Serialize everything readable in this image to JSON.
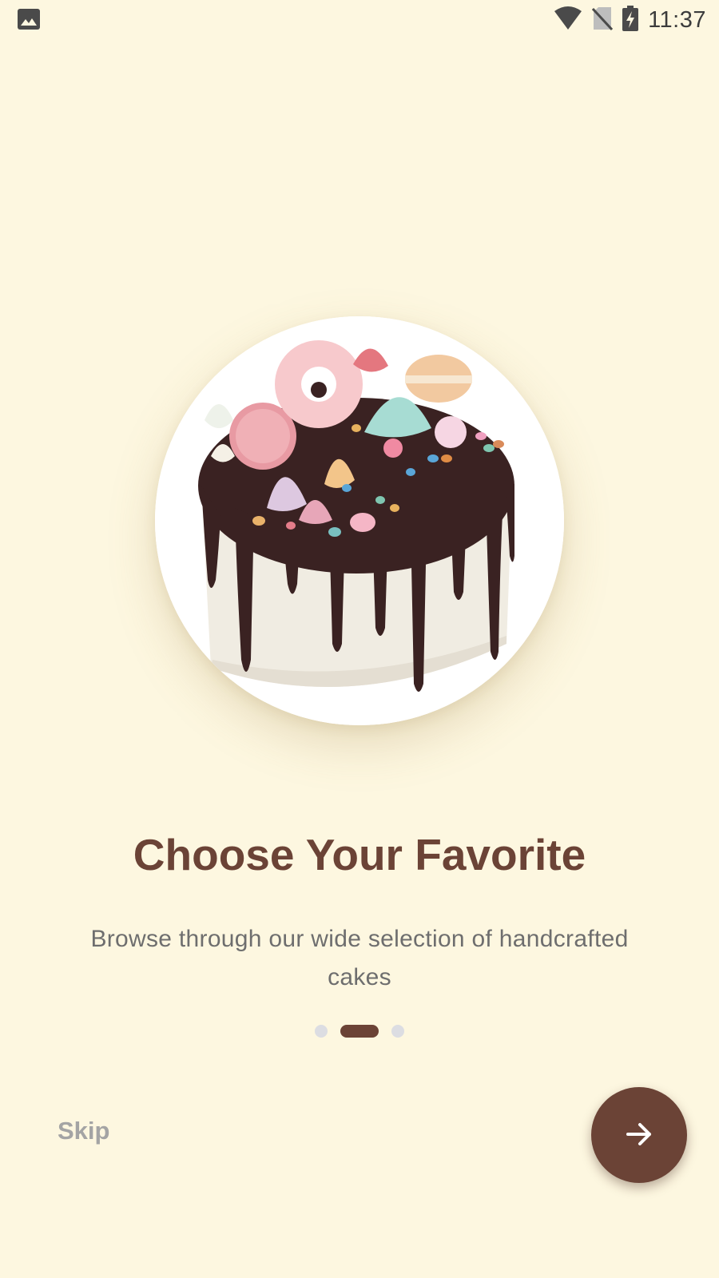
{
  "status_bar": {
    "time": "11:37",
    "icons": [
      "gallery-icon",
      "wifi-icon",
      "no-sim-icon",
      "battery-charging-icon"
    ]
  },
  "hero": {
    "image": "chocolate-drip-cake-with-meringues-and-macarons"
  },
  "onboarding": {
    "title": "Choose Your Favorite",
    "description": "Browse through our wide selection of handcrafted cakes",
    "page_indicator": {
      "total": 3,
      "current": 2
    }
  },
  "actions": {
    "skip_label": "Skip",
    "next_icon": "arrow-right-icon"
  },
  "colors": {
    "background": "#fdf7e0",
    "accent": "#6b4336",
    "inactive_dot": "#dcdde2",
    "skip_text": "#a4a4a4",
    "body_text": "#6e6e6e"
  }
}
